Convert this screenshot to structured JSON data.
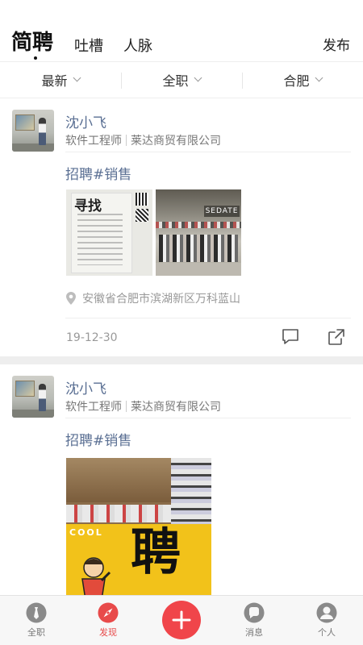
{
  "header": {
    "tabs": [
      {
        "label": "简聘",
        "active": true
      },
      {
        "label": "吐槽",
        "active": false
      },
      {
        "label": "人脉",
        "active": false
      }
    ],
    "publish_label": "发布"
  },
  "filters": [
    {
      "label": "最新"
    },
    {
      "label": "全职"
    },
    {
      "label": "合肥"
    }
  ],
  "posts": [
    {
      "author": "沈小飞",
      "role": "软件工程师",
      "company": "莱达商贸有限公司",
      "title": "招聘#销售",
      "images": [
        {
          "poster_text": "寻找"
        },
        {
          "store_sign": "SEDATE"
        }
      ],
      "location": "安徽省合肥市滨湖新区万科蓝山",
      "date": "19-12-30"
    },
    {
      "author": "沈小飞",
      "role": "软件工程师",
      "company": "莱达商贸有限公司",
      "title": "招聘#销售",
      "images": [
        {
          "banner_text": "COOL",
          "big_char": "聘"
        }
      ]
    }
  ],
  "bottom_nav": [
    {
      "label": "全职",
      "active": false
    },
    {
      "label": "发现",
      "active": true
    },
    {
      "label": "",
      "icon": "plus-icon"
    },
    {
      "label": "消息",
      "active": false
    },
    {
      "label": "个人",
      "active": false
    }
  ],
  "colors": {
    "accent": "#f0454a",
    "link": "#5a6f93",
    "muted": "#999999"
  }
}
